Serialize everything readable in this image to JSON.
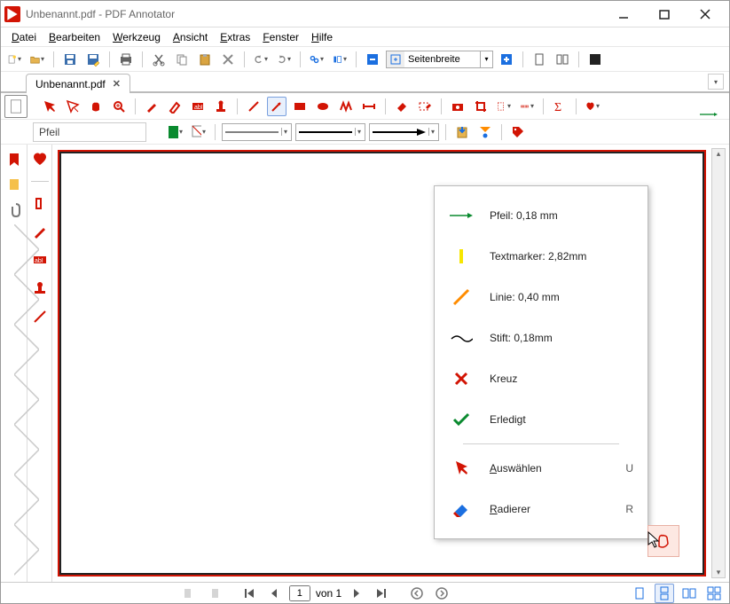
{
  "window": {
    "title": "Unbenannt.pdf - PDF Annotator"
  },
  "menu": {
    "items": [
      {
        "label": "Datei",
        "u": 0
      },
      {
        "label": "Bearbeiten",
        "u": 0
      },
      {
        "label": "Werkzeug",
        "u": 0
      },
      {
        "label": "Ansicht",
        "u": 0
      },
      {
        "label": "Extras",
        "u": 0
      },
      {
        "label": "Fenster",
        "u": 0
      },
      {
        "label": "Hilfe",
        "u": 0
      }
    ]
  },
  "zoom": {
    "value": "Seitenbreite"
  },
  "tab": {
    "label": "Unbenannt.pdf"
  },
  "tool": {
    "current": "Pfeil"
  },
  "status": {
    "page_input": "1",
    "page_total": "von 1"
  },
  "colors": {
    "accent": "#d21404",
    "green": "#0a8a2f",
    "orange": "#ff8c00",
    "blue": "#1b6fe0",
    "yellow": "#f7e600"
  },
  "popup": {
    "items": [
      {
        "id": "arrow",
        "label": "Pfeil: 0,18 mm"
      },
      {
        "id": "marker",
        "label": "Textmarker: 2,82mm"
      },
      {
        "id": "line",
        "label": "Linie: 0,40 mm"
      },
      {
        "id": "pen",
        "label": "Stift: 0,18mm"
      },
      {
        "id": "cross",
        "label": "Kreuz"
      },
      {
        "id": "done",
        "label": "Erledigt"
      }
    ],
    "actions": [
      {
        "id": "select",
        "label": "Auswählen",
        "shortcut": "U",
        "u": 0
      },
      {
        "id": "eraser",
        "label": "Radierer",
        "shortcut": "R",
        "u": 0
      }
    ]
  }
}
